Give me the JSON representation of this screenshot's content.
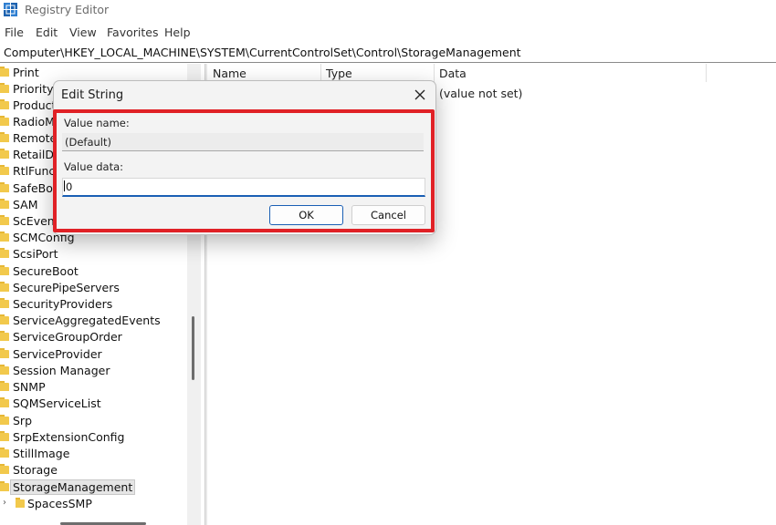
{
  "window": {
    "title": "Registry Editor"
  },
  "menu": [
    "File",
    "Edit",
    "View",
    "Favorites",
    "Help"
  ],
  "address": "Computer\\HKEY_LOCAL_MACHINE\\SYSTEM\\CurrentControlSet\\Control\\StorageManagement",
  "tree": {
    "items": [
      "Print",
      "PriorityC",
      "ProductO",
      "RadioM",
      "Remote",
      "RetailDe",
      "RtlFunct",
      "SafeBoo",
      "SAM",
      "ScEvent",
      "SCMConfig",
      "ScsiPort",
      "SecureBoot",
      "SecurePipeServers",
      "SecurityProviders",
      "ServiceAggregatedEvents",
      "ServiceGroupOrder",
      "ServiceProvider",
      "Session Manager",
      "SNMP",
      "SQMServiceList",
      "Srp",
      "SrpExtensionConfig",
      "StillImage",
      "Storage",
      "StorageManagement",
      "SpacesSMP"
    ],
    "selected": "StorageManagement",
    "expandable": "SpacesSMP"
  },
  "list": {
    "columns": [
      "Name",
      "Type",
      "Data"
    ],
    "rows": [
      {
        "data": "(value not set)"
      }
    ]
  },
  "dialog": {
    "title": "Edit String",
    "value_name_label": "Value name:",
    "value_name": "(Default)",
    "value_data_label": "Value data:",
    "value_data": "0",
    "ok_label": "OK",
    "cancel_label": "Cancel"
  },
  "colors": {
    "highlight": "#e02126",
    "accent": "#1a5fb4",
    "folder": "#f2c94c"
  },
  "icons": {
    "app": "registry-editor-icon",
    "close": "close-icon",
    "folder": "folder-icon",
    "expander": "chevron-right-icon"
  }
}
